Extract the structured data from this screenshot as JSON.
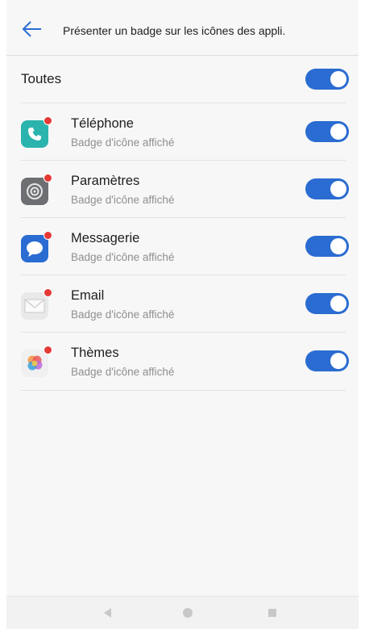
{
  "header": {
    "title": "Présenter un badge sur les icônes des appli.",
    "back_icon": "back-arrow-icon"
  },
  "all_row": {
    "label": "Toutes",
    "toggle_on": true
  },
  "apps": [
    {
      "name": "Téléphone",
      "status": "Badge d'icône affiché",
      "icon": "phone-icon",
      "icon_color": "#2bb3ad",
      "toggle_on": true
    },
    {
      "name": "Paramètres",
      "status": "Badge d'icône affiché",
      "icon": "settings-icon",
      "icon_color": "#6d6f73",
      "toggle_on": true
    },
    {
      "name": "Messagerie",
      "status": "Badge d'icône affiché",
      "icon": "message-icon",
      "icon_color": "#2a6cd1",
      "toggle_on": true
    },
    {
      "name": "Email",
      "status": "Badge d'icône affiché",
      "icon": "email-icon",
      "icon_color": "#e9e9e9",
      "toggle_on": true
    },
    {
      "name": "Thèmes",
      "status": "Badge d'icône affiché",
      "icon": "themes-icon",
      "icon_color": "#f0f0f0",
      "toggle_on": true
    }
  ],
  "colors": {
    "accent": "#2a6cd1",
    "badge": "#e53935",
    "background": "#f7f7f7"
  },
  "navbar": {
    "back_icon": "nav-back-icon",
    "home_icon": "nav-home-icon",
    "recents_icon": "nav-recents-icon"
  }
}
